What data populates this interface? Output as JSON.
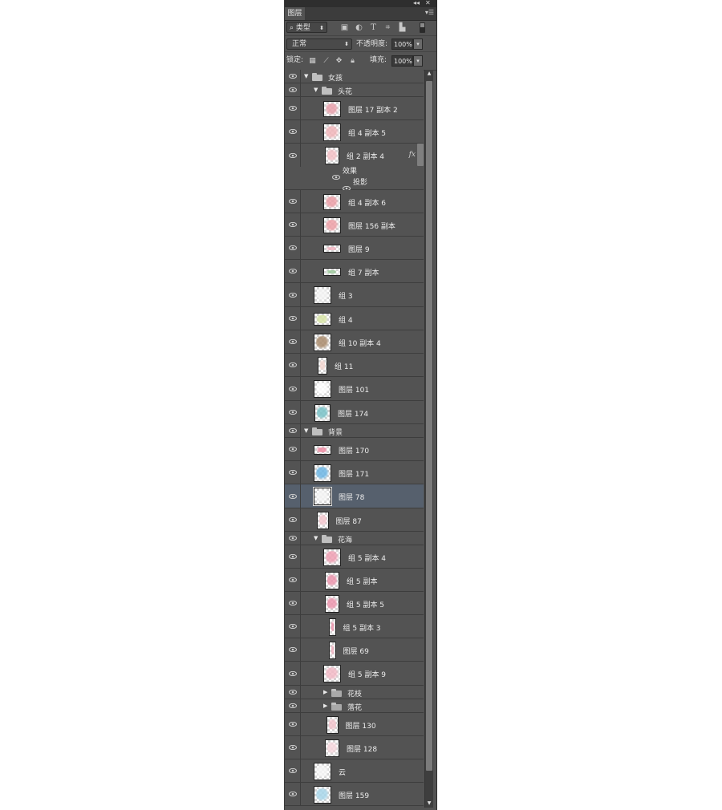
{
  "panel": {
    "title_buttons": {
      "collapse": "◂◂",
      "close": "✕"
    },
    "tab_label": "图层",
    "menu_icon": "panel-menu-icon",
    "filter": {
      "kind_label": "类型",
      "search_icon": "⌕",
      "icons": [
        "image-filter-icon",
        "adjustment-filter-icon",
        "type-filter-icon",
        "shape-filter-icon",
        "smart-object-filter-icon"
      ]
    },
    "blend_mode": "正常",
    "opacity_label": "不透明度:",
    "opacity_value": "100%",
    "lock_label": "锁定:",
    "lock_icons": [
      "lock-transparent-icon",
      "lock-paint-icon",
      "lock-move-icon",
      "lock-all-icon"
    ],
    "fill_label": "填充:",
    "fill_value": "100%"
  },
  "layers": [
    {
      "name": "女孩",
      "type": "group",
      "expanded": true,
      "indent": 0
    },
    {
      "name": "头花",
      "type": "group",
      "expanded": true,
      "indent": 1
    },
    {
      "name": "图层 17 副本 2",
      "type": "layer",
      "indent": 2,
      "thumb": "#e8a0ab"
    },
    {
      "name": "组 4 副本 5",
      "type": "layer",
      "indent": 2,
      "thumb": "#f1b5b9"
    },
    {
      "name": "组 2 副本 4",
      "type": "layer",
      "indent": 2,
      "thumb": "#f3c0c6",
      "fx": "fx",
      "effects_label": "效果",
      "effects": [
        "投影"
      ]
    },
    {
      "name": "组 4 副本 6",
      "type": "layer",
      "indent": 2,
      "thumb": "#ec9ea6"
    },
    {
      "name": "图层 156 副本",
      "type": "layer",
      "indent": 2,
      "thumb": "#ee9fa6"
    },
    {
      "name": "图层 9",
      "type": "layer",
      "indent": 2,
      "thumb": "#f2b6c2"
    },
    {
      "name": "组 7 副本",
      "type": "layer",
      "indent": 2,
      "thumb": "#9bc79a"
    },
    {
      "name": "组 3",
      "type": "layer",
      "indent": 1,
      "thumb": "#f4f4f4"
    },
    {
      "name": "组 4",
      "type": "layer",
      "indent": 1,
      "thumb": "#d9e6a8"
    },
    {
      "name": "组 10 副本 4",
      "type": "layer",
      "indent": 1,
      "thumb": "#a98b6c"
    },
    {
      "name": "组 11",
      "type": "layer",
      "indent": 1,
      "thumb": "#f3d6d0"
    },
    {
      "name": "图层 101",
      "type": "layer",
      "indent": 1,
      "thumb": "#ffffff"
    },
    {
      "name": "图层 174",
      "type": "layer",
      "indent": 1,
      "thumb": "#79c2c7"
    },
    {
      "name": "背景",
      "type": "group",
      "expanded": true,
      "indent": 0
    },
    {
      "name": "图层 170",
      "type": "layer",
      "indent": 1,
      "thumb": "#ef8ea5"
    },
    {
      "name": "图层 171",
      "type": "layer",
      "indent": 1,
      "thumb": "#6cb6e4"
    },
    {
      "name": "图层 78",
      "type": "layer",
      "indent": 1,
      "thumb": "#f5f5f5",
      "selected": true
    },
    {
      "name": "图层 87",
      "type": "layer",
      "indent": 1,
      "thumb": "#f4c7cf"
    },
    {
      "name": "花海",
      "type": "group",
      "expanded": true,
      "indent": 1
    },
    {
      "name": "组 5 副本 4",
      "type": "layer",
      "indent": 2,
      "thumb": "#ef9fb3"
    },
    {
      "name": "组 5 副本",
      "type": "layer",
      "indent": 2,
      "thumb": "#ec95ad"
    },
    {
      "name": "组 5 副本 5",
      "type": "layer",
      "indent": 2,
      "thumb": "#ec95ad"
    },
    {
      "name": "组 5 副本 3",
      "type": "layer",
      "indent": 2,
      "thumb": "#ec95ad"
    },
    {
      "name": "图层 69",
      "type": "layer",
      "indent": 2,
      "thumb": "#f0b1bf"
    },
    {
      "name": "组 5 副本 9",
      "type": "layer",
      "indent": 2,
      "thumb": "#f3b9c6"
    },
    {
      "name": "花枝",
      "type": "group",
      "expanded": false,
      "indent": 2
    },
    {
      "name": "落花",
      "type": "group",
      "expanded": false,
      "indent": 2
    },
    {
      "name": "图层 130",
      "type": "layer",
      "indent": 2,
      "thumb": "#f3c4cd"
    },
    {
      "name": "图层 128",
      "type": "layer",
      "indent": 2,
      "thumb": "#f6d7dd"
    },
    {
      "name": "云",
      "type": "layer",
      "indent": 1,
      "thumb": "#f6f6f6"
    },
    {
      "name": "图层 159",
      "type": "layer",
      "indent": 1,
      "thumb": "#a8d6ea"
    }
  ]
}
